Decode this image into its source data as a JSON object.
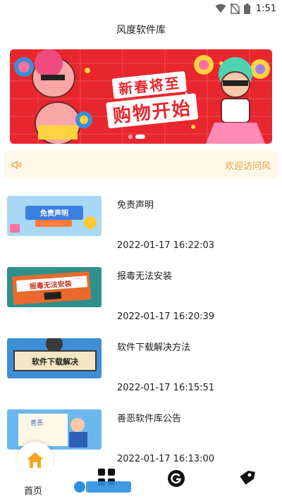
{
  "status_bar": {
    "time": "1:51",
    "icons": [
      "wifi-icon",
      "no-sim-icon",
      "battery-icon"
    ]
  },
  "app_bar": {
    "title": "风度软件库"
  },
  "banner": {
    "line1": "新春将至",
    "line2": "购物开始",
    "slides": 2,
    "active_slide": 1
  },
  "notice": {
    "text": "欢迎访问风",
    "icon": "speaker-icon",
    "color": "#e9a23b"
  },
  "articles": [
    {
      "title": "免责声明",
      "date": "2022-01-17 16:22:03",
      "thumb_text": "免责声明"
    },
    {
      "title": "报毒无法安装",
      "date": "2022-01-17 16:20:39",
      "thumb_text": "报毒无法安装"
    },
    {
      "title": "软件下载解决方法",
      "date": "2022-01-17 16:15:51",
      "thumb_text": "软件下载解决"
    },
    {
      "title": "善恶软件库公告",
      "date": "2022-01-17 16:13:00",
      "thumb_text": "善恶"
    }
  ],
  "tab_bar": {
    "home_label": "首页",
    "tabs": [
      "home-icon",
      "grid-icon",
      "g-logo-icon",
      "tag-icon"
    ],
    "accent": "#f5a623"
  },
  "colors": {
    "banner_red": "#e8262d",
    "notice_bg": "#fff7ea"
  }
}
